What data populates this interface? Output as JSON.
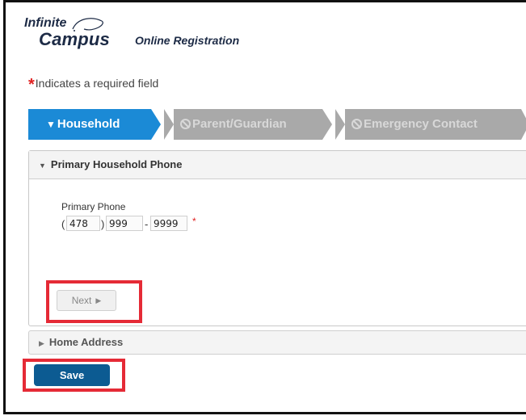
{
  "logo": {
    "top_text": "Infinite",
    "main_text": "Campus",
    "subtitle": "Online Registration"
  },
  "required_note": {
    "marker": "*",
    "text": "Indicates a required field"
  },
  "tabs": [
    {
      "label": "Household",
      "state": "active"
    },
    {
      "label": "Parent/Guardian",
      "state": "disabled"
    },
    {
      "label": "Emergency Contact",
      "state": "disabled"
    }
  ],
  "phone_section": {
    "title": "Primary Household Phone",
    "field_label": "Primary Phone",
    "area_code": "478",
    "prefix": "999",
    "line_number": "9999",
    "required_marker": "*",
    "next_label": "Next"
  },
  "address_section": {
    "title": "Home Address"
  },
  "save_label": "Save",
  "colors": {
    "active_tab": "#1b8ad6",
    "disabled_tab": "#a9a9a9",
    "save_button": "#0c5b92",
    "highlight": "#e52a36",
    "required": "#e02020"
  }
}
